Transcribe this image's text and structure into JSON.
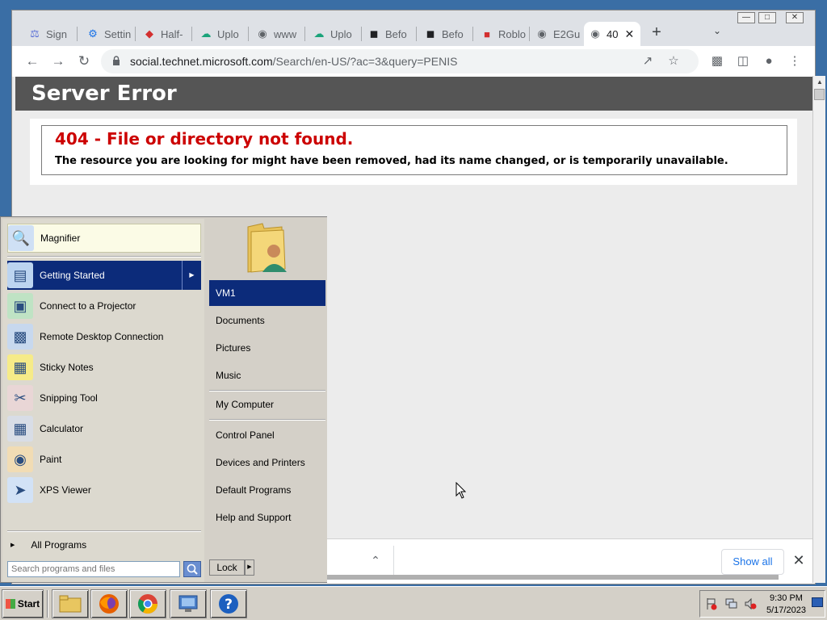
{
  "browser": {
    "tabs": [
      {
        "label": "Sign",
        "icon": "flask-icon",
        "color": "#5a6fd6"
      },
      {
        "label": "Settin",
        "icon": "gear-icon",
        "color": "#1a73e8"
      },
      {
        "label": "Half-",
        "icon": "roblox-red-icon",
        "color": "#d32f2f"
      },
      {
        "label": "Uplo",
        "icon": "upload-cloud-icon",
        "color": "#1aa37a"
      },
      {
        "label": "www",
        "icon": "globe-icon",
        "color": "#5f6368"
      },
      {
        "label": "Uplo",
        "icon": "upload-cloud-icon",
        "color": "#1aa37a"
      },
      {
        "label": "Befo",
        "icon": "shield-icon",
        "color": "#202124"
      },
      {
        "label": "Befo",
        "icon": "shield-icon",
        "color": "#202124"
      },
      {
        "label": "Roblo",
        "icon": "roblox-icon",
        "color": "#d32f2f"
      },
      {
        "label": "E2Gu",
        "icon": "globe-icon",
        "color": "#5f6368"
      },
      {
        "label": "40",
        "icon": "globe-icon",
        "color": "#5f6368",
        "active": true
      }
    ],
    "new_tab_label": "+",
    "url_host": "social.technet.microsoft.com",
    "url_path": "/Search/en-US/?ac=3&query=PENIS"
  },
  "page": {
    "header_title": "Server Error",
    "error_code": "404 - File or directory not found.",
    "error_message": "The resource you are looking for might have been removed, had its name changed, or is temporarily unavailable."
  },
  "download_bar": {
    "show_all_label": "Show all"
  },
  "start_menu": {
    "pinned": [
      {
        "label": "Magnifier",
        "icon": "magnifier-icon"
      }
    ],
    "recent": [
      {
        "label": "Getting Started",
        "icon": "getting-started-icon",
        "highlighted": true,
        "has_submenu": true
      },
      {
        "label": "Connect to a Projector",
        "icon": "projector-icon"
      },
      {
        "label": "Remote Desktop Connection",
        "icon": "remote-desktop-icon"
      },
      {
        "label": "Sticky Notes",
        "icon": "sticky-notes-icon"
      },
      {
        "label": "Snipping Tool",
        "icon": "scissors-icon"
      },
      {
        "label": "Calculator",
        "icon": "calculator-icon"
      },
      {
        "label": "Paint",
        "icon": "paint-palette-icon"
      },
      {
        "label": "XPS Viewer",
        "icon": "xps-viewer-icon"
      }
    ],
    "all_programs_label": "All Programs",
    "search_placeholder": "Search programs and files",
    "right_items_group1": [
      {
        "label": "VM1",
        "highlighted": true
      },
      {
        "label": "Documents"
      },
      {
        "label": "Pictures"
      },
      {
        "label": "Music"
      }
    ],
    "right_items_group2": [
      {
        "label": "My Computer"
      }
    ],
    "right_items_group3": [
      {
        "label": "Control Panel"
      },
      {
        "label": "Devices and Printers"
      },
      {
        "label": "Default Programs"
      },
      {
        "label": "Help and Support"
      }
    ],
    "lock_label": "Lock"
  },
  "taskbar": {
    "start_label": "Start",
    "apps": [
      {
        "name": "file-explorer-icon"
      },
      {
        "name": "firefox-icon"
      },
      {
        "name": "chrome-icon"
      },
      {
        "name": "server-manager-icon"
      },
      {
        "name": "help-icon"
      }
    ],
    "clock_time": "9:30 PM",
    "clock_date": "5/17/2023"
  },
  "colors": {
    "error_red": "#cc0000",
    "header_gray": "#555555",
    "selection_blue": "#0c2b7a",
    "link_blue": "#1a73e8"
  }
}
